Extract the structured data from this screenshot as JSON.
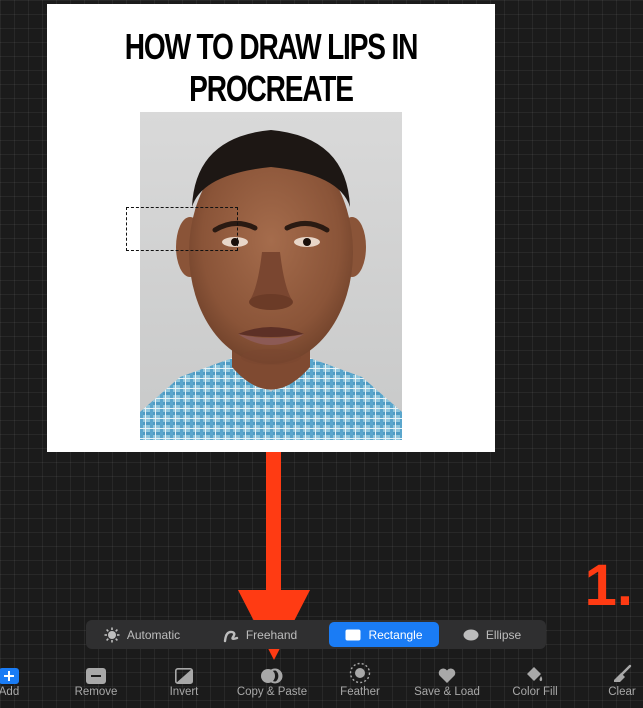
{
  "canvas": {
    "title_line1": "HOW TO DRAW LIPS IN",
    "title_line2": "PROCREATE"
  },
  "annotation": {
    "step_number": "1."
  },
  "selection_modes": [
    {
      "label": "Automatic",
      "icon": "sun-icon",
      "active": false
    },
    {
      "label": "Freehand",
      "icon": "freehand-icon",
      "active": false
    },
    {
      "label": "Rectangle",
      "icon": "rectangle-icon",
      "active": true
    },
    {
      "label": "Ellipse",
      "icon": "ellipse-icon",
      "active": false
    }
  ],
  "toolbar": {
    "items": [
      {
        "label": "Add",
        "icon": "plus-icon"
      },
      {
        "label": "Remove",
        "icon": "minus-icon"
      },
      {
        "label": "Invert",
        "icon": "invert-icon"
      },
      {
        "label": "Copy & Paste",
        "icon": "copy-paste-icon"
      },
      {
        "label": "Feather",
        "icon": "feather-icon"
      },
      {
        "label": "Save & Load",
        "icon": "heart-icon"
      },
      {
        "label": "Color Fill",
        "icon": "color-fill-icon"
      },
      {
        "label": "Clear",
        "icon": "clear-brush-icon"
      }
    ]
  },
  "colors": {
    "accent_blue": "#1a7cf5",
    "arrow_red": "#ff3b13",
    "workspace_bg": "#1b1b1b"
  }
}
